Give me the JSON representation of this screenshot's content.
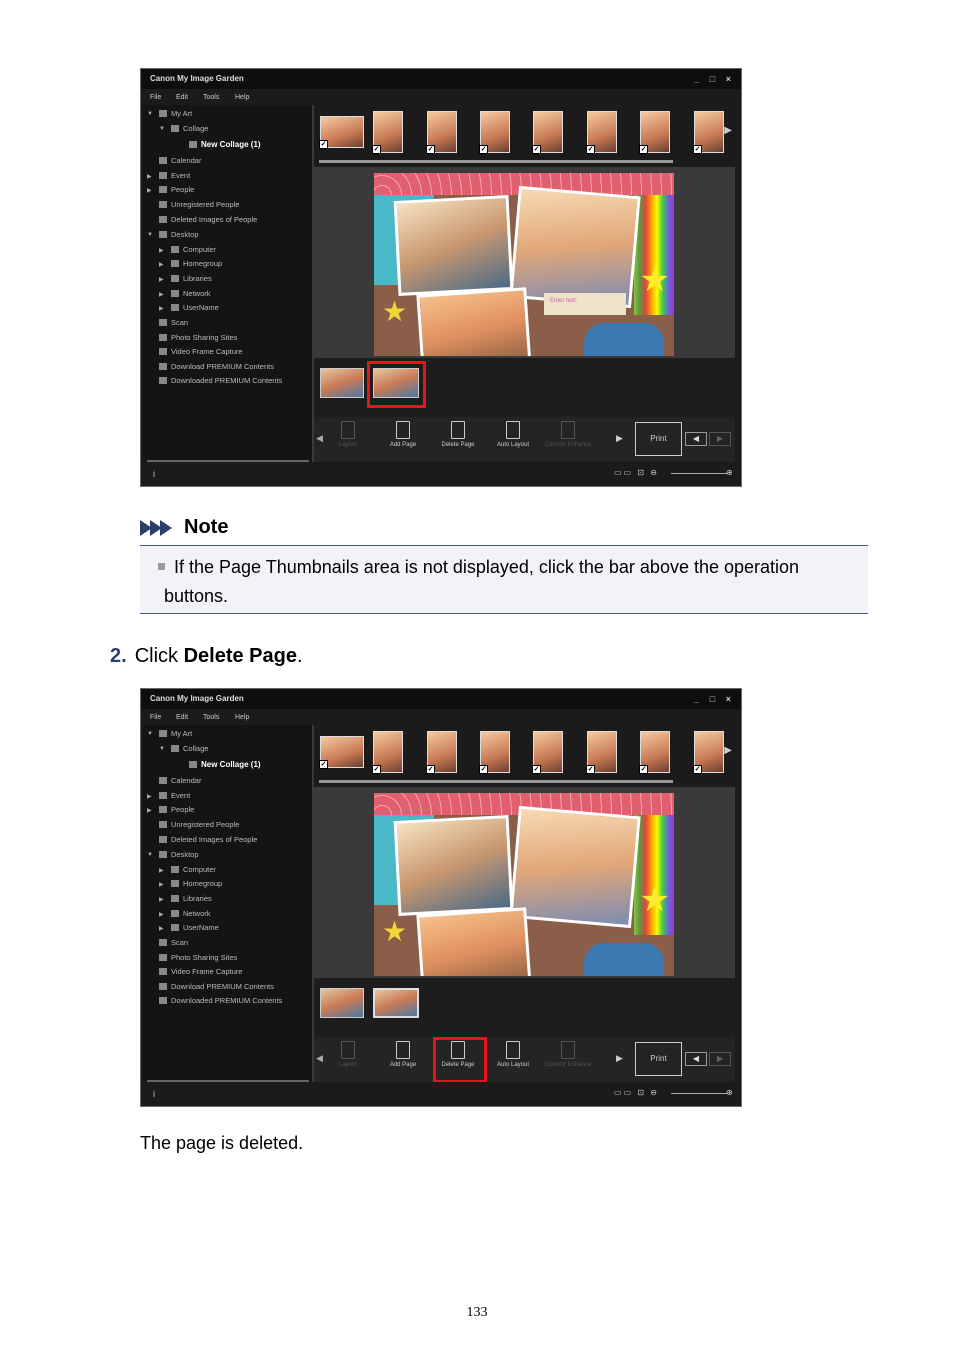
{
  "screenshots": [
    {
      "window_title": "Canon My Image Garden",
      "window_controls": "_ □ ×",
      "menu": [
        "File",
        "Edit",
        "Tools",
        "Help"
      ],
      "sidebar": [
        {
          "label": "My Art",
          "level": 0,
          "expand": "▼"
        },
        {
          "label": "Collage",
          "level": 1,
          "expand": "▼"
        },
        {
          "label": "New Collage (1)",
          "level": 2,
          "expand": "",
          "selected": true
        },
        {
          "label": "Calendar",
          "level": 0,
          "expand": ""
        },
        {
          "label": "Event",
          "level": 0,
          "expand": "▶"
        },
        {
          "label": "People",
          "level": 0,
          "expand": "▶"
        },
        {
          "label": "Unregistered People",
          "level": 0,
          "expand": ""
        },
        {
          "label": "Deleted Images of People",
          "level": 0,
          "expand": ""
        },
        {
          "label": "Desktop",
          "level": 0,
          "expand": "▼"
        },
        {
          "label": "Computer",
          "level": 1,
          "expand": "▶"
        },
        {
          "label": "Homegroup",
          "level": 1,
          "expand": "▶"
        },
        {
          "label": "Libraries",
          "level": 1,
          "expand": "▶"
        },
        {
          "label": "Network",
          "level": 1,
          "expand": "▶"
        },
        {
          "label": "UserName",
          "level": 1,
          "expand": "▶"
        },
        {
          "label": "Scan",
          "level": 0,
          "expand": ""
        },
        {
          "label": "Photo Sharing Sites",
          "level": 0,
          "expand": ""
        },
        {
          "label": "Video Frame Capture",
          "level": 0,
          "expand": ""
        },
        {
          "label": "Download PREMIUM Contents",
          "level": 0,
          "expand": ""
        },
        {
          "label": "Downloaded PREMIUM Contents",
          "level": 0,
          "expand": ""
        }
      ],
      "canvas_text": {
        "enter_text": "Enter text.",
        "small_text": "Enter text."
      },
      "operations": [
        {
          "label": "Layout",
          "disabled": true
        },
        {
          "label": "Add Page",
          "disabled": false
        },
        {
          "label": "Delete Page",
          "disabled": false
        },
        {
          "label": "Auto Layout",
          "disabled": false
        },
        {
          "label": "Correct/ Enhance",
          "disabled": true
        }
      ],
      "print_label": "Print",
      "highlight": "page-thumbnail-2"
    },
    {
      "window_title": "Canon My Image Garden",
      "window_controls": "_ □ ×",
      "menu": [
        "File",
        "Edit",
        "Tools",
        "Help"
      ],
      "operations": [
        {
          "label": "Layout",
          "disabled": true
        },
        {
          "label": "Add Page",
          "disabled": false
        },
        {
          "label": "Delete Page",
          "disabled": false
        },
        {
          "label": "Auto Layout",
          "disabled": false
        },
        {
          "label": "Correct/ Enhance",
          "disabled": true
        }
      ],
      "print_label": "Print",
      "highlight": "delete-page-button"
    }
  ],
  "note": {
    "title": "Note",
    "text": "If the Page Thumbnails area is not displayed, click the bar above the operation buttons."
  },
  "step": {
    "number": "2.",
    "prefix": "Click ",
    "bold": "Delete Page",
    "suffix": "."
  },
  "result": "The page is deleted.",
  "page_number": "133",
  "colors": {
    "highlight_red": "#e8141c",
    "note_accent": "#2c3e6a",
    "note_bg": "#f1f3f9"
  }
}
